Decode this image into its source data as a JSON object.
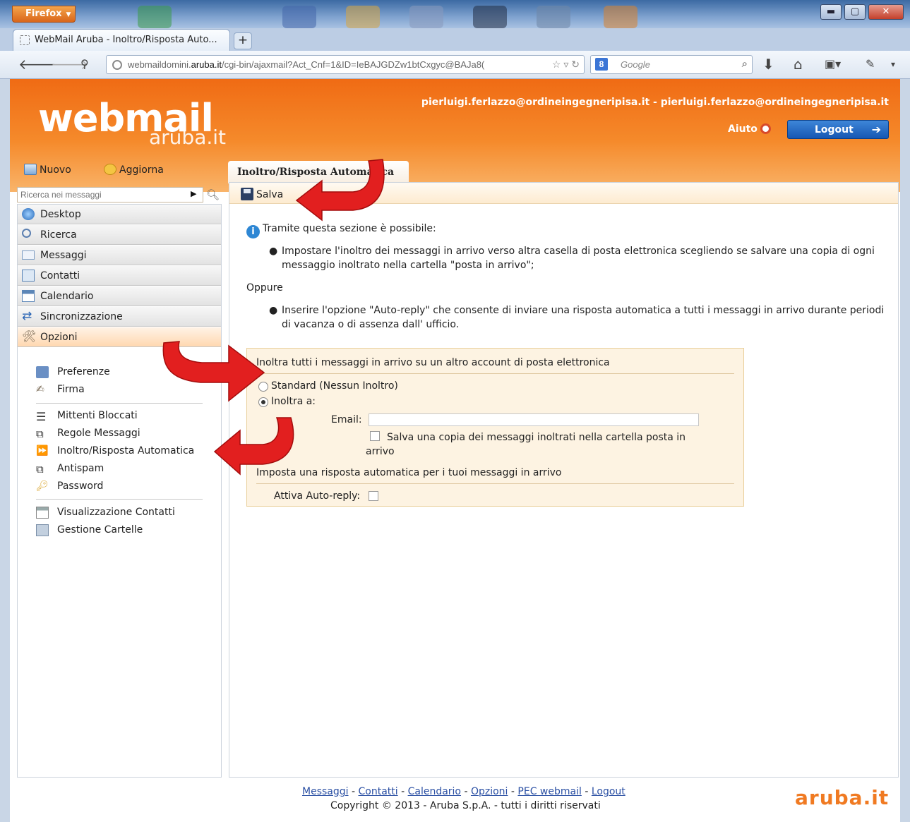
{
  "browser": {
    "menu_button": "Firefox",
    "tab_title": "WebMail Aruba - Inoltro/Risposta Auto...",
    "new_tab": "+",
    "url_prefix": "webmaildomini.",
    "url_domain": "aruba.it",
    "url_rest": "/cgi-bin/ajaxmail?Act_Cnf=1&ID=IeBAJGDZw1btCxgyc@BAJa8(",
    "search_engine": "Google",
    "window_controls": [
      "minimize",
      "maximize",
      "close"
    ]
  },
  "header": {
    "logo_main": "webmail",
    "logo_sub": "aruba.it",
    "user": "pierluigi.ferlazzo@ordineingegneripisa.it - pierluigi.ferlazzo@ordineingegneripisa.it",
    "help_label": "Aiuto",
    "logout_label": "Logout",
    "accent_color": "#f06b14"
  },
  "actions": {
    "new_label": "Nuovo",
    "refresh_label": "Aggiorna"
  },
  "search": {
    "placeholder": "Ricerca nei messaggi"
  },
  "sidebar": {
    "nav": [
      {
        "label": "Desktop",
        "icon": "globe-icon"
      },
      {
        "label": "Ricerca",
        "icon": "magnifier-icon"
      },
      {
        "label": "Messaggi",
        "icon": "envelope-icon"
      },
      {
        "label": "Contatti",
        "icon": "address-book-icon"
      },
      {
        "label": "Calendario",
        "icon": "calendar-icon"
      },
      {
        "label": "Sincronizzazione",
        "icon": "sync-icon"
      },
      {
        "label": "Opzioni",
        "icon": "tools-icon"
      }
    ],
    "options": [
      {
        "label": "Preferenze",
        "icon": "user-prefs-icon"
      },
      {
        "label": "Firma",
        "icon": "pen-icon"
      },
      {
        "label": "Mittenti Bloccati",
        "icon": "list-icon"
      },
      {
        "label": "Regole Messaggi",
        "icon": "rules-icon"
      },
      {
        "label": "Inoltro/Risposta Automatica",
        "icon": "forward-icon"
      },
      {
        "label": "Antispam",
        "icon": "antispam-icon"
      },
      {
        "label": "Password",
        "icon": "key-icon"
      },
      {
        "label": "Visualizzazione Contatti",
        "icon": "contacts-view-icon"
      },
      {
        "label": "Gestione Cartelle",
        "icon": "folders-icon"
      }
    ]
  },
  "main": {
    "tab_title": "Inoltro/Risposta Automatica",
    "save_label": "Salva",
    "intro": "Tramite questa sezione è possibile:",
    "bullet1": "Impostare l'inoltro dei messaggi in arrivo verso altra casella di posta elettronica scegliendo se salvare una copia di ogni messaggio inoltrato nella cartella \"posta in arrivo\";",
    "or_label": "Oppure",
    "bullet2": "Inserire l'opzione \"Auto-reply\" che consente di inviare una risposta automatica a tutti i messaggi in arrivo durante periodi di vacanza o di assenza dall' ufficio.",
    "forward_section": "Inoltra tutti i messaggi in arrivo su un altro account di posta elettronica",
    "radio_standard": "Standard (Nessun Inoltro)",
    "radio_forward": "Inoltra a:",
    "radio_selected": "Inoltra a:",
    "email_label": "Email:",
    "email_value": "",
    "keep_copy_label": "Salva una copia dei messaggi inoltrati nella cartella posta in arrivo",
    "keep_copy_checked": false,
    "autoreply_section": "Imposta una risposta automatica per i tuoi messaggi in arrivo",
    "autoreply_label": "Attiva Auto-reply:",
    "autoreply_checked": false
  },
  "footer": {
    "links": [
      "Messaggi",
      "Contatti",
      "Calendario",
      "Opzioni",
      "PEC webmail",
      "Logout"
    ],
    "separator": " - ",
    "copyright": "Copyright © 2013 - Aruba S.p.A. - tutti i diritti riservati",
    "logo": "aruba.it"
  }
}
